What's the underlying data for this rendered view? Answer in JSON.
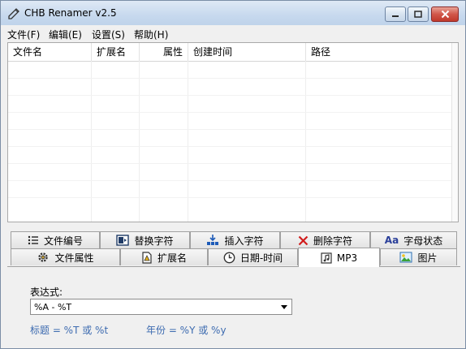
{
  "window": {
    "title": "CHB Renamer v2.5"
  },
  "menu": [
    "文件(F)",
    "编辑(E)",
    "设置(S)",
    "帮助(H)"
  ],
  "file_list": {
    "columns": [
      "文件名",
      "扩展名",
      "属性",
      "创建时间",
      "路径"
    ],
    "rows": []
  },
  "tabs_row1": [
    {
      "label": "文件编号",
      "icon": "numbered-list-icon"
    },
    {
      "label": "替换字符",
      "icon": "replace-icon"
    },
    {
      "label": "插入字符",
      "icon": "insert-icon"
    },
    {
      "label": "删除字符",
      "icon": "delete-x-icon"
    },
    {
      "label": "字母状态",
      "icon": "letter-case-icon",
      "icon_text": "Aa"
    }
  ],
  "tabs_row2": [
    {
      "label": "文件属性",
      "icon": "gear-icon"
    },
    {
      "label": "扩展名",
      "icon": "file-warning-icon"
    },
    {
      "label": "日期-时间",
      "icon": "clock-icon"
    },
    {
      "label": "MP3",
      "icon": "music-file-icon",
      "active": true
    },
    {
      "label": "图片",
      "icon": "picture-icon"
    }
  ],
  "mp3_panel": {
    "expression_label": "表达式:",
    "expression_value": "%A - %T",
    "hints": [
      "标题 = %T 或 %t",
      "年份 = %Y 或 %y"
    ]
  },
  "colors": {
    "titlebar": "#c7d9ee",
    "close_button": "#c0392b",
    "hint_text": "#3d6bb0"
  }
}
